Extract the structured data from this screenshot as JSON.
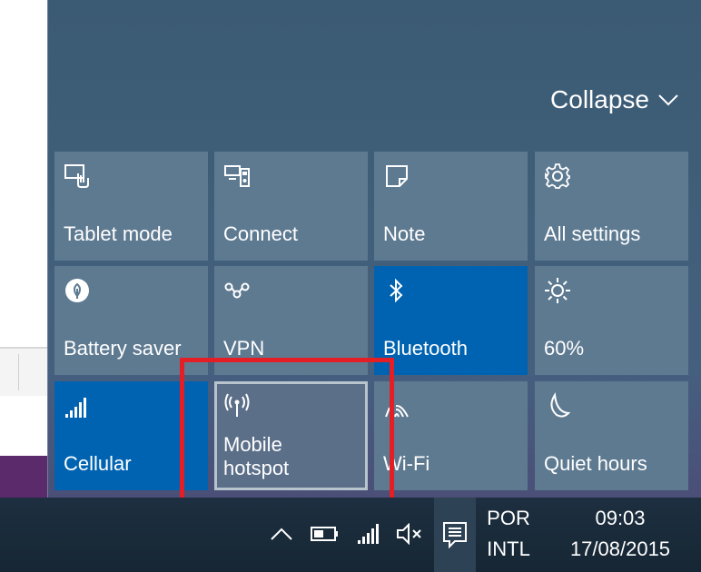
{
  "panel": {
    "collapse_label": "Collapse",
    "tiles": [
      {
        "label": "Tablet mode",
        "icon": "tablet-mode-icon",
        "active": false
      },
      {
        "label": "Connect",
        "icon": "connect-icon",
        "active": false
      },
      {
        "label": "Note",
        "icon": "note-icon",
        "active": false
      },
      {
        "label": "All settings",
        "icon": "gear-icon",
        "active": false
      },
      {
        "label": "Battery saver",
        "icon": "battery-saver-icon",
        "active": false
      },
      {
        "label": "VPN",
        "icon": "vpn-icon",
        "active": false
      },
      {
        "label": "Bluetooth",
        "icon": "bluetooth-icon",
        "active": true
      },
      {
        "label": "60%",
        "icon": "brightness-icon",
        "active": false
      },
      {
        "label": "Cellular",
        "icon": "cellular-icon",
        "active": true
      },
      {
        "label": "Mobile\nhotspot",
        "label_line1": "Mobile",
        "label_line2": "hotspot",
        "icon": "mobile-hotspot-icon",
        "active": false,
        "highlighted": true
      },
      {
        "label": "Wi-Fi",
        "icon": "wifi-icon",
        "active": false
      },
      {
        "label": "Quiet hours",
        "icon": "moon-icon",
        "active": false
      }
    ]
  },
  "taskbar": {
    "tray_icons": [
      "chevron-up-icon",
      "battery-icon",
      "signal-icon",
      "volume-muted-icon",
      "action-center-icon"
    ],
    "language_line1": "POR",
    "language_line2": "INTL",
    "time": "09:03",
    "date": "17/08/2015"
  },
  "colors": {
    "panel_bg": "#3f5f79",
    "tile_bg": "#5e7a91",
    "tile_active": "#0063b1",
    "annotation": "#e31e24",
    "taskbar_bg": "#1d2f40"
  }
}
